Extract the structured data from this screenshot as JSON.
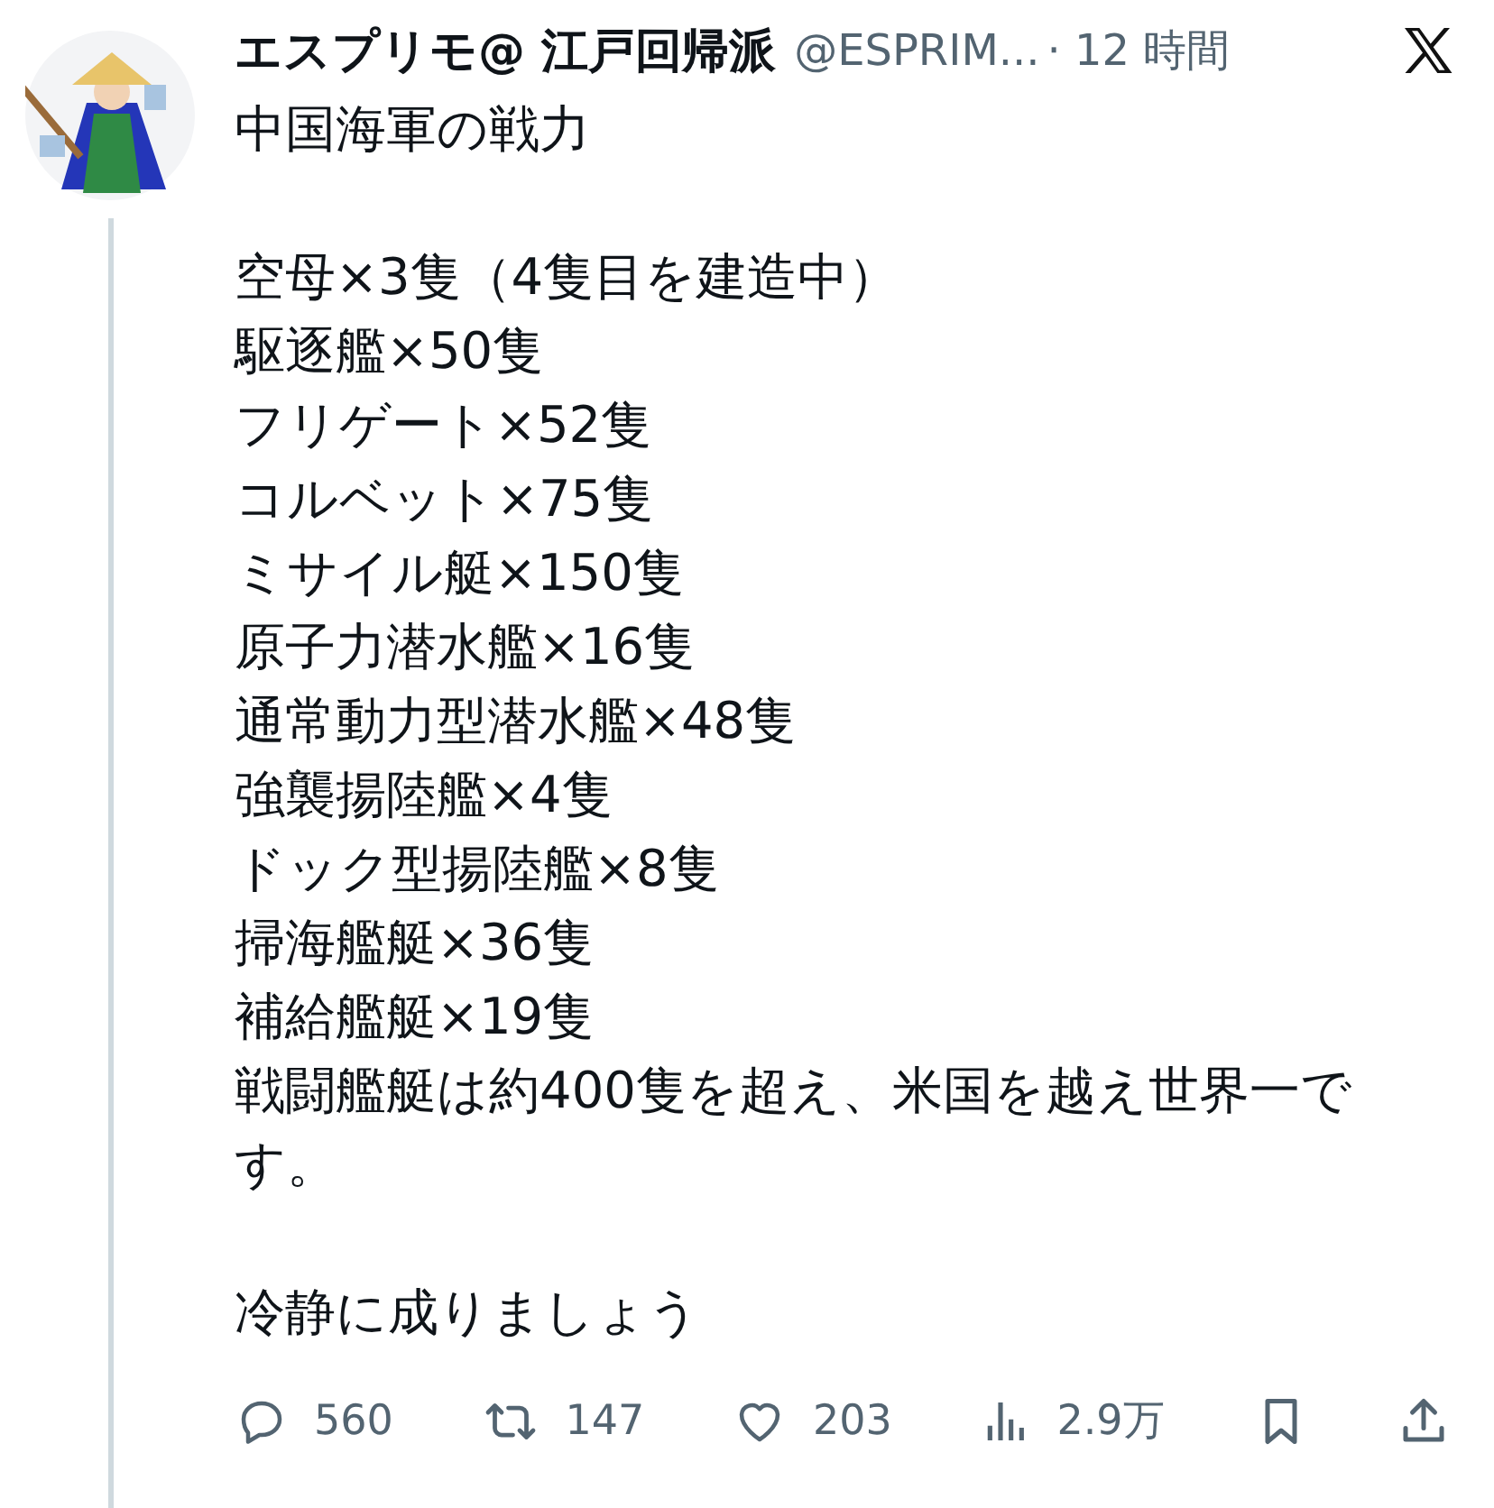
{
  "author": {
    "name": "エスプリモ@ 江戸回帰派",
    "handle": "@ESPRIM...",
    "time": "· 12 時間"
  },
  "text": [
    [
      "中国海軍の戦力"
    ],
    [
      "空母×3隻（4隻目を建造中）",
      "駆逐艦×50隻",
      "フリゲート×52隻",
      "コルベット×75隻",
      "ミサイル艇×150隻",
      "原子力潜水艦×16隻",
      "通常動力型潜水艦×48隻",
      "強襲揚陸艦×4隻",
      "ドック型揚陸艦×8隻",
      "掃海艦艇×36隻",
      "補給艦艇×19隻",
      "戦闘艦艇は約400隻を超え、米国を越え世界一です。"
    ],
    [
      "冷静に成りましょう"
    ]
  ],
  "actions": [
    {
      "kind": "reply",
      "count": "560"
    },
    {
      "kind": "repost",
      "count": "147"
    },
    {
      "kind": "like",
      "count": "203"
    },
    {
      "kind": "views",
      "count": "2.9万"
    },
    {
      "kind": "bookmark"
    },
    {
      "kind": "share"
    }
  ]
}
